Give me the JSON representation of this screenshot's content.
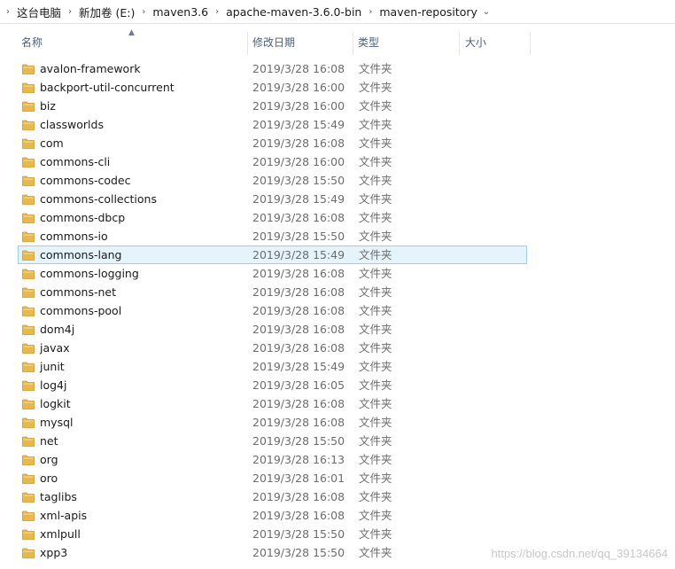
{
  "breadcrumb": [
    "这台电脑",
    "新加卷 (E:)",
    "maven3.6",
    "apache-maven-3.6.0-bin",
    "maven-repository"
  ],
  "columns": {
    "name": "名称",
    "date": "修改日期",
    "type": "类型",
    "size": "大小"
  },
  "selected_index": 10,
  "files": [
    {
      "name": "avalon-framework",
      "date": "2019/3/28 16:08",
      "type": "文件夹"
    },
    {
      "name": "backport-util-concurrent",
      "date": "2019/3/28 16:00",
      "type": "文件夹"
    },
    {
      "name": "biz",
      "date": "2019/3/28 16:00",
      "type": "文件夹"
    },
    {
      "name": "classworlds",
      "date": "2019/3/28 15:49",
      "type": "文件夹"
    },
    {
      "name": "com",
      "date": "2019/3/28 16:08",
      "type": "文件夹"
    },
    {
      "name": "commons-cli",
      "date": "2019/3/28 16:00",
      "type": "文件夹"
    },
    {
      "name": "commons-codec",
      "date": "2019/3/28 15:50",
      "type": "文件夹"
    },
    {
      "name": "commons-collections",
      "date": "2019/3/28 15:49",
      "type": "文件夹"
    },
    {
      "name": "commons-dbcp",
      "date": "2019/3/28 16:08",
      "type": "文件夹"
    },
    {
      "name": "commons-io",
      "date": "2019/3/28 15:50",
      "type": "文件夹"
    },
    {
      "name": "commons-lang",
      "date": "2019/3/28 15:49",
      "type": "文件夹"
    },
    {
      "name": "commons-logging",
      "date": "2019/3/28 16:08",
      "type": "文件夹"
    },
    {
      "name": "commons-net",
      "date": "2019/3/28 16:08",
      "type": "文件夹"
    },
    {
      "name": "commons-pool",
      "date": "2019/3/28 16:08",
      "type": "文件夹"
    },
    {
      "name": "dom4j",
      "date": "2019/3/28 16:08",
      "type": "文件夹"
    },
    {
      "name": "javax",
      "date": "2019/3/28 16:08",
      "type": "文件夹"
    },
    {
      "name": "junit",
      "date": "2019/3/28 15:49",
      "type": "文件夹"
    },
    {
      "name": "log4j",
      "date": "2019/3/28 16:05",
      "type": "文件夹"
    },
    {
      "name": "logkit",
      "date": "2019/3/28 16:08",
      "type": "文件夹"
    },
    {
      "name": "mysql",
      "date": "2019/3/28 16:08",
      "type": "文件夹"
    },
    {
      "name": "net",
      "date": "2019/3/28 15:50",
      "type": "文件夹"
    },
    {
      "name": "org",
      "date": "2019/3/28 16:13",
      "type": "文件夹"
    },
    {
      "name": "oro",
      "date": "2019/3/28 16:01",
      "type": "文件夹"
    },
    {
      "name": "taglibs",
      "date": "2019/3/28 16:08",
      "type": "文件夹"
    },
    {
      "name": "xml-apis",
      "date": "2019/3/28 16:08",
      "type": "文件夹"
    },
    {
      "name": "xmlpull",
      "date": "2019/3/28 15:50",
      "type": "文件夹"
    },
    {
      "name": "xpp3",
      "date": "2019/3/28 15:50",
      "type": "文件夹"
    }
  ],
  "watermark": "https://blog.csdn.net/qq_39134664",
  "colors": {
    "folder": "#e8b84a",
    "selection_bg": "#e5f3fb",
    "selection_border": "#99d1f0"
  }
}
